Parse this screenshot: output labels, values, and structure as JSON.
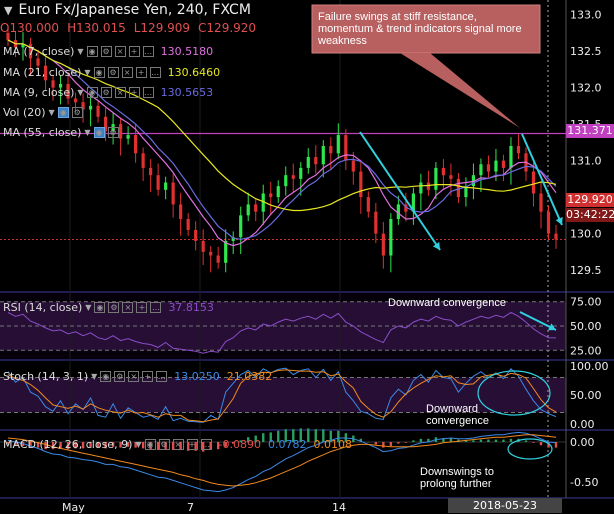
{
  "header": {
    "symbol_title": "Euro Fx/Japanese Yen, 240, FXCM",
    "open": "O130.000",
    "high": "H130.015",
    "low": "L129.909",
    "close": "C129.920"
  },
  "indicators": {
    "ma7": {
      "label": "MA (7, close)",
      "value": "130.5180",
      "color": "#e070e0"
    },
    "ma21": {
      "label": "MA (21, close)",
      "value": "130.6460",
      "color": "#e6e620"
    },
    "ma9": {
      "label": "MA (9, close)",
      "value": "130.5653",
      "color": "#6a6ae0"
    },
    "vol": {
      "label": "Vol (20)"
    },
    "ma55": {
      "label": "MA (55, close)"
    },
    "rsi": {
      "label": "RSI (14, close)",
      "value": "37.8153",
      "color": "#8a4ec8"
    },
    "stoch": {
      "label": "Stoch (14, 3, 1)",
      "k": "13.0250",
      "d": "21.0382",
      "k_color": "#3a8ae8",
      "d_color": "#f08a20"
    },
    "macd": {
      "label": "MACD (12, 26, close, 9)",
      "hist": "-0.0890",
      "macd": "0.0782",
      "signal": "0.0108"
    }
  },
  "annotations": {
    "callout": "Failure swings at stiff resistance, momentum & trend indicators signal more weakness",
    "rsi_note": "Downward convergence",
    "stoch_note_1": "Downward",
    "stoch_note_2": "convergence",
    "macd_note_1": "Downswings to",
    "macd_note_2": "prolong further"
  },
  "price_tags": {
    "resistance": "131.371",
    "last": "129.920",
    "countdown": "03:42:22"
  },
  "time_axis": {
    "labels": [
      "May",
      "7",
      "14"
    ],
    "cursor": "2018-05-23 05:00:00"
  },
  "chart_data": [
    {
      "type": "candlestick",
      "title": "Euro Fx/Japanese Yen, 240, FXCM",
      "ylim": [
        129.2,
        133.2
      ],
      "yticks": [
        133.0,
        132.5,
        132.0,
        131.5,
        131.0,
        130.5,
        130.0,
        129.5
      ],
      "resistance_level": 131.371,
      "last_price": 129.92,
      "close": [
        132.65,
        132.55,
        132.6,
        132.4,
        132.3,
        132.1,
        132.0,
        132.05,
        131.85,
        131.8,
        131.7,
        131.75,
        131.6,
        131.4,
        131.5,
        131.3,
        131.35,
        131.1,
        130.9,
        130.8,
        130.6,
        130.7,
        130.4,
        130.2,
        130.05,
        129.9,
        129.75,
        129.7,
        129.6,
        129.9,
        129.95,
        130.25,
        130.4,
        130.3,
        130.55,
        130.5,
        130.65,
        130.8,
        130.75,
        130.9,
        131.05,
        130.95,
        131.2,
        131.1,
        131.35,
        131.0,
        130.85,
        130.5,
        130.3,
        130.0,
        129.7,
        130.2,
        130.4,
        130.3,
        130.55,
        130.7,
        130.6,
        130.9,
        130.8,
        130.75,
        130.5,
        130.65,
        130.8,
        130.95,
        130.85,
        131.0,
        130.9,
        131.2,
        131.1,
        130.85,
        130.55,
        130.3,
        130.0,
        129.92
      ],
      "series": [
        {
          "name": "MA (7, close)",
          "last": 130.518
        },
        {
          "name": "MA (21, close)",
          "last": 130.646
        },
        {
          "name": "MA (9, close)",
          "last": 130.5653
        }
      ]
    },
    {
      "type": "line",
      "title": "RSI (14, close)",
      "ylim": [
        15,
        85
      ],
      "yticks": [
        75,
        50,
        25
      ],
      "series": [
        {
          "name": "RSI (14, close)",
          "values": [
            64,
            60,
            62,
            55,
            52,
            48,
            45,
            46,
            42,
            44,
            40,
            43,
            38,
            36,
            40,
            35,
            37,
            34,
            32,
            31,
            28,
            33,
            27,
            26,
            25,
            24,
            22,
            24,
            23,
            34,
            38,
            45,
            48,
            46,
            52,
            50,
            54,
            57,
            55,
            58,
            60,
            57,
            62,
            58,
            63,
            54,
            50,
            44,
            40,
            36,
            33,
            46,
            50,
            48,
            54,
            57,
            55,
            60,
            57,
            56,
            50,
            54,
            57,
            60,
            58,
            61,
            59,
            64,
            60,
            54,
            47,
            42,
            38,
            37.8
          ]
        }
      ]
    },
    {
      "type": "line",
      "title": "Stoch (14, 3, 1)",
      "ylim": [
        -10,
        110
      ],
      "yticks": [
        100,
        50,
        0
      ],
      "series": [
        {
          "name": "%K",
          "values": [
            90,
            72,
            80,
            55,
            48,
            30,
            22,
            40,
            18,
            35,
            25,
            45,
            15,
            12,
            35,
            10,
            28,
            20,
            12,
            15,
            8,
            30,
            6,
            10,
            5,
            4,
            3,
            15,
            8,
            55,
            70,
            85,
            92,
            80,
            95,
            88,
            94,
            96,
            85,
            92,
            95,
            80,
            94,
            75,
            90,
            55,
            40,
            22,
            18,
            10,
            8,
            45,
            60,
            50,
            75,
            85,
            72,
            92,
            80,
            78,
            55,
            70,
            82,
            90,
            80,
            88,
            78,
            95,
            82,
            60,
            40,
            25,
            18,
            13.03
          ]
        },
        {
          "name": "%D",
          "values": [
            85,
            78,
            75,
            68,
            58,
            45,
            33,
            30,
            27,
            31,
            26,
            35,
            28,
            24,
            21,
            19,
            24,
            19,
            20,
            16,
            12,
            18,
            15,
            15,
            7,
            6,
            4,
            7,
            9,
            26,
            44,
            70,
            82,
            86,
            89,
            88,
            92,
            93,
            92,
            91,
            91,
            89,
            90,
            83,
            86,
            73,
            62,
            39,
            27,
            17,
            12,
            21,
            38,
            52,
            62,
            70,
            77,
            83,
            81,
            83,
            71,
            68,
            69,
            81,
            84,
            86,
            82,
            87,
            85,
            79,
            61,
            42,
            28,
            21.04
          ]
        }
      ]
    },
    {
      "type": "line",
      "title": "MACD (12, 26, close, 9)",
      "ylim": [
        -0.7,
        0.15
      ],
      "yticks": [
        0.0,
        -0.5
      ],
      "series": [
        {
          "name": "MACD",
          "values": [
            0.02,
            0.0,
            -0.02,
            -0.05,
            -0.08,
            -0.12,
            -0.15,
            -0.16,
            -0.19,
            -0.2,
            -0.22,
            -0.23,
            -0.25,
            -0.28,
            -0.28,
            -0.31,
            -0.32,
            -0.35,
            -0.38,
            -0.41,
            -0.44,
            -0.45,
            -0.48,
            -0.51,
            -0.54,
            -0.57,
            -0.6,
            -0.61,
            -0.62,
            -0.6,
            -0.57,
            -0.52,
            -0.47,
            -0.43,
            -0.37,
            -0.33,
            -0.27,
            -0.21,
            -0.17,
            -0.12,
            -0.07,
            -0.04,
            0.0,
            0.02,
            0.05,
            0.05,
            0.04,
            0.01,
            -0.03,
            -0.07,
            -0.12,
            -0.11,
            -0.08,
            -0.07,
            -0.04,
            -0.01,
            0.0,
            0.03,
            0.04,
            0.05,
            0.04,
            0.04,
            0.05,
            0.07,
            0.08,
            0.09,
            0.09,
            0.11,
            0.12,
            0.11,
            0.08,
            0.04,
            0.0,
            -0.01
          ]
        },
        {
          "name": "Signal",
          "values": [
            0.05,
            0.04,
            0.03,
            0.01,
            -0.01,
            -0.03,
            -0.06,
            -0.08,
            -0.1,
            -0.12,
            -0.14,
            -0.16,
            -0.18,
            -0.2,
            -0.22,
            -0.24,
            -0.26,
            -0.28,
            -0.3,
            -0.32,
            -0.34,
            -0.36,
            -0.38,
            -0.41,
            -0.43,
            -0.46,
            -0.48,
            -0.51,
            -0.53,
            -0.54,
            -0.55,
            -0.54,
            -0.53,
            -0.51,
            -0.48,
            -0.45,
            -0.41,
            -0.37,
            -0.33,
            -0.29,
            -0.24,
            -0.2,
            -0.16,
            -0.12,
            -0.09,
            -0.06,
            -0.04,
            -0.03,
            -0.03,
            -0.04,
            -0.05,
            -0.06,
            -0.06,
            -0.06,
            -0.06,
            -0.05,
            -0.04,
            -0.03,
            -0.01,
            0.0,
            0.01,
            0.02,
            0.03,
            0.04,
            0.05,
            0.06,
            0.06,
            0.07,
            0.08,
            0.09,
            0.09,
            0.08,
            0.07,
            0.06
          ]
        }
      ]
    }
  ]
}
